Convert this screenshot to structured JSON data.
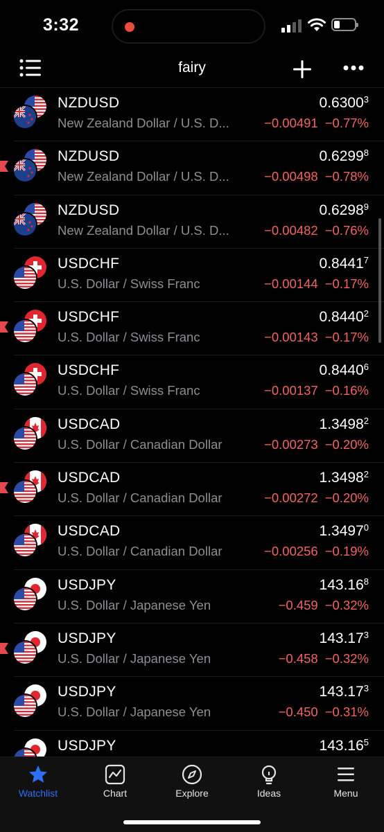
{
  "status": {
    "time": "3:32"
  },
  "header": {
    "title": "fairy"
  },
  "rows": [
    {
      "symbol": "NZDUSD",
      "description": "New Zealand Dollar / U.S. D...",
      "price_main": "0.6300",
      "price_sup": "3",
      "change": "−0.00491",
      "change_pct": "−0.77%",
      "pair": "nzd",
      "flagged": false
    },
    {
      "symbol": "NZDUSD",
      "description": "New Zealand Dollar / U.S. D...",
      "price_main": "0.6299",
      "price_sup": "8",
      "change": "−0.00498",
      "change_pct": "−0.78%",
      "pair": "nzd",
      "flagged": true
    },
    {
      "symbol": "NZDUSD",
      "description": "New Zealand Dollar / U.S. D...",
      "price_main": "0.6298",
      "price_sup": "9",
      "change": "−0.00482",
      "change_pct": "−0.76%",
      "pair": "nzd",
      "flagged": false
    },
    {
      "symbol": "USDCHF",
      "description": "U.S. Dollar / Swiss Franc",
      "price_main": "0.8441",
      "price_sup": "7",
      "change": "−0.00144",
      "change_pct": "−0.17%",
      "pair": "chf",
      "flagged": false
    },
    {
      "symbol": "USDCHF",
      "description": "U.S. Dollar / Swiss Franc",
      "price_main": "0.8440",
      "price_sup": "2",
      "change": "−0.00143",
      "change_pct": "−0.17%",
      "pair": "chf",
      "flagged": true
    },
    {
      "symbol": "USDCHF",
      "description": "U.S. Dollar / Swiss Franc",
      "price_main": "0.8440",
      "price_sup": "6",
      "change": "−0.00137",
      "change_pct": "−0.16%",
      "pair": "chf",
      "flagged": false
    },
    {
      "symbol": "USDCAD",
      "description": "U.S. Dollar / Canadian Dollar",
      "price_main": "1.3498",
      "price_sup": "2",
      "change": "−0.00273",
      "change_pct": "−0.20%",
      "pair": "cad",
      "flagged": false
    },
    {
      "symbol": "USDCAD",
      "description": "U.S. Dollar / Canadian Dollar",
      "price_main": "1.3498",
      "price_sup": "2",
      "change": "−0.00272",
      "change_pct": "−0.20%",
      "pair": "cad",
      "flagged": true
    },
    {
      "symbol": "USDCAD",
      "description": "U.S. Dollar / Canadian Dollar",
      "price_main": "1.3497",
      "price_sup": "0",
      "change": "−0.00256",
      "change_pct": "−0.19%",
      "pair": "cad",
      "flagged": false
    },
    {
      "symbol": "USDJPY",
      "description": "U.S. Dollar / Japanese Yen",
      "price_main": "143.16",
      "price_sup": "8",
      "change": "−0.459",
      "change_pct": "−0.32%",
      "pair": "jpy",
      "flagged": false
    },
    {
      "symbol": "USDJPY",
      "description": "U.S. Dollar / Japanese Yen",
      "price_main": "143.17",
      "price_sup": "3",
      "change": "−0.458",
      "change_pct": "−0.32%",
      "pair": "jpy",
      "flagged": true
    },
    {
      "symbol": "USDJPY",
      "description": "U.S. Dollar / Japanese Yen",
      "price_main": "143.17",
      "price_sup": "3",
      "change": "−0.450",
      "change_pct": "−0.31%",
      "pair": "jpy",
      "flagged": false
    },
    {
      "symbol": "USDJPY",
      "description": "",
      "price_main": "143.16",
      "price_sup": "5",
      "change": "",
      "change_pct": "",
      "pair": "jpy",
      "flagged": false
    }
  ],
  "tabs": [
    {
      "label": "Watchlist",
      "icon": "star-icon",
      "active": true
    },
    {
      "label": "Chart",
      "icon": "chart-icon",
      "active": false
    },
    {
      "label": "Explore",
      "icon": "compass-icon",
      "active": false
    },
    {
      "label": "Ideas",
      "icon": "lightbulb-icon",
      "active": false
    },
    {
      "label": "Menu",
      "icon": "hamburger-icon",
      "active": false
    }
  ],
  "colors": {
    "negative": "#f06464",
    "accent": "#2d6ff6",
    "muted": "#8e8e93",
    "flag_marker": "#e5484d"
  }
}
